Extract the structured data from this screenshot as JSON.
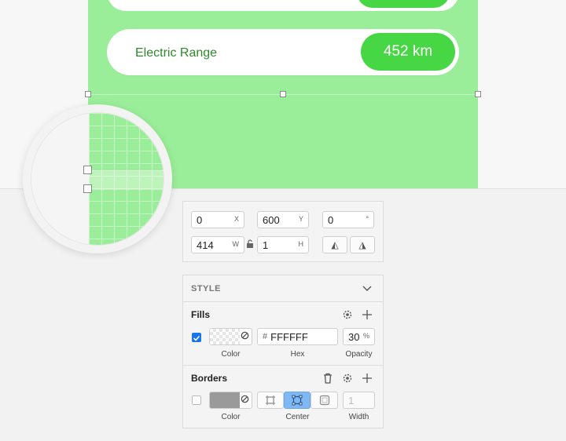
{
  "canvas": {
    "artboard_color": "#9bee99",
    "accent_green": "#47d745",
    "row_label": "Electric Range",
    "row_value": "452 km"
  },
  "inspector": {
    "x_value": "0",
    "x_suffix": "X",
    "y_value": "600",
    "y_suffix": "Y",
    "rotation_value": "0",
    "rotation_suffix": "°",
    "w_value": "414",
    "w_suffix": "W",
    "h_value": "1",
    "h_suffix": "H",
    "flip_horizontal_icon": "◭",
    "flip_vertical_icon": "◮"
  },
  "style": {
    "title": "STYLE",
    "fills": {
      "title": "Fills",
      "enabled": true,
      "hex_prefix": "#",
      "hex": "FFFFFF",
      "opacity": "30",
      "opacity_suffix": "%",
      "color_caption": "Color",
      "hex_caption": "Hex",
      "opacity_caption": "Opacity"
    },
    "borders": {
      "title": "Borders",
      "enabled": false,
      "width_placeholder": "1",
      "color_caption": "Color",
      "position_caption": "Center",
      "width_caption": "Width",
      "selected_position": "center"
    }
  }
}
